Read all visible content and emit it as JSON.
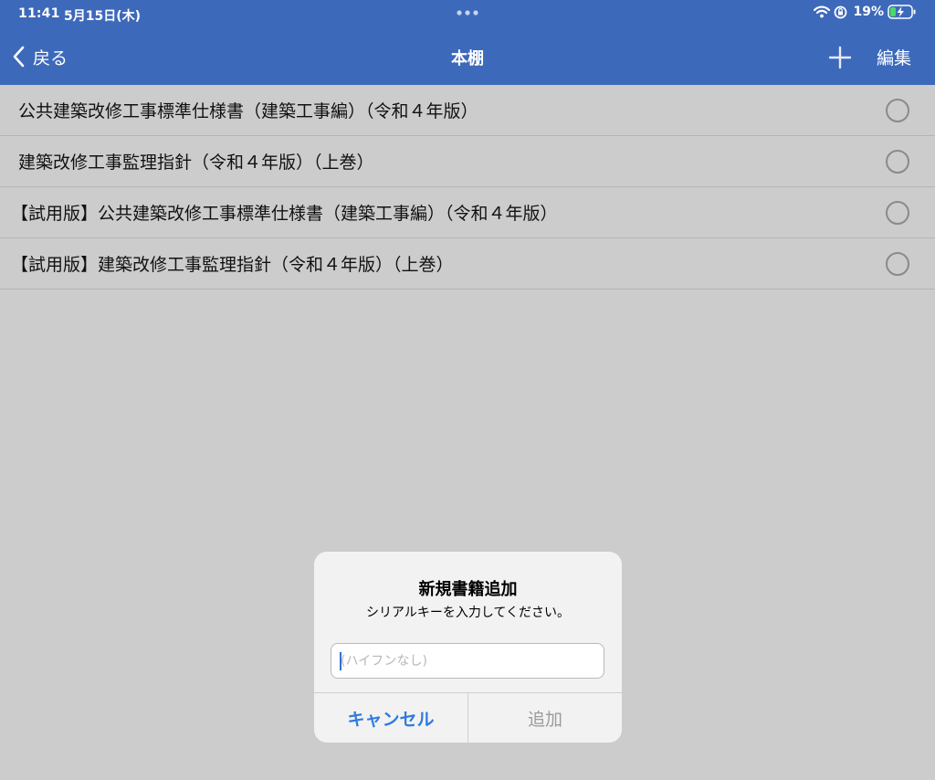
{
  "status_bar": {
    "time": "11:41",
    "date": "5月15日(木)",
    "battery": "19%",
    "icons": [
      "multitask-dots-icon",
      "wifi-icon",
      "orientation-lock-icon",
      "battery-charging-icon"
    ]
  },
  "nav": {
    "back_label": "戻る",
    "title": "本棚",
    "add_icon": "plus-icon",
    "edit_label": "編集"
  },
  "books": [
    {
      "title": "公共建築改修工事標準仕様書（建築工事編）（令和４年版）",
      "trial": false
    },
    {
      "title": "建築改修工事監理指針（令和４年版）（上巻）",
      "trial": false
    },
    {
      "title": "【試用版】公共建築改修工事標準仕様書（建築工事編）（令和４年版）",
      "trial": true
    },
    {
      "title": "【試用版】建築改修工事監理指針（令和４年版）（上巻）",
      "trial": true
    }
  ],
  "alert": {
    "title": "新規書籍追加",
    "message": "シリアルキーを入力してください。",
    "input_value": "",
    "input_placeholder": "(ハイフンなし)",
    "cancel_label": "キャンセル",
    "add_label": "追加"
  },
  "colors": {
    "header": "#3d69bb",
    "background": "#cccccc",
    "accent": "#2f7be0",
    "disabled": "#9b9b9b"
  }
}
